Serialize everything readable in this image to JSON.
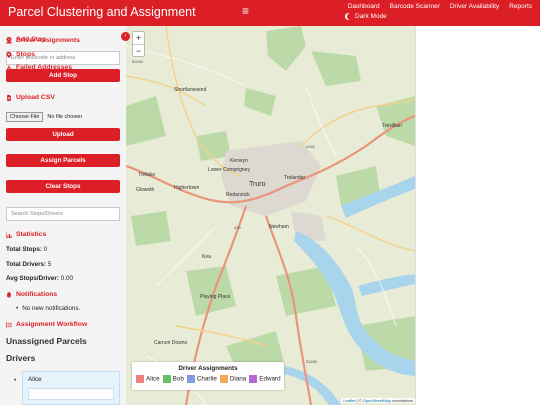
{
  "navbar": {
    "brand": "Parcel Clustering and Assignment",
    "hamburger": "≡",
    "links": [
      "Dashboard",
      "Barcode Scanner",
      "Driver Availability",
      "Reports"
    ],
    "dark_mode": "Dark Mode"
  },
  "sidebar": {
    "collapse": "‹",
    "add_stop": {
      "heading": "Add Stop",
      "placeholder": "Enter postcode or address",
      "button": "Add Stop"
    },
    "upload": {
      "heading": "Upload CSV",
      "file_button": "Choose File",
      "file_status": "No file chosen",
      "button": "Upload"
    },
    "assign_button": "Assign Parcels",
    "clear_button": "Clear Stops",
    "search_placeholder": "Search Stops/Drivers",
    "statistics": {
      "heading": "Statistics",
      "total_stops_label": "Total Stops:",
      "total_stops": "0",
      "total_drivers_label": "Total Drivers:",
      "total_drivers": "5",
      "avg_label": "Avg Stops/Driver:",
      "avg": "0.00"
    },
    "notifications": {
      "heading": "Notifications",
      "items": [
        "No new notifications."
      ]
    },
    "workflow_heading": "Assignment Workflow",
    "unassigned_heading": "Unassigned Parcels",
    "drivers_heading": "Drivers",
    "drivers": [
      {
        "name": "Alice"
      }
    ]
  },
  "map": {
    "zoom_in": "+",
    "zoom_out": "−",
    "place_labels": [
      "Shortlanesend",
      "Kenwyn",
      "Lower Comprigney",
      "Truro",
      "Trelander",
      "Gloweth",
      "Highertown",
      "Redannick",
      "Newham",
      "Treliske",
      "Kea",
      "Playing Place",
      "Carnon Downs",
      "Tresillian"
    ],
    "road_labels": [
      "B3284",
      "A390",
      "A39",
      "B3289"
    ],
    "legend": {
      "title": "Driver Assignments",
      "items": [
        {
          "name": "Alice",
          "color": "#f08080"
        },
        {
          "name": "Bob",
          "color": "#66c266"
        },
        {
          "name": "Charlie",
          "color": "#7f9fe0"
        },
        {
          "name": "Diana",
          "color": "#f0a860"
        },
        {
          "name": "Edward",
          "color": "#b06ad0"
        }
      ]
    },
    "attribution": {
      "leaflet": "Leaflet",
      "separator": " | © ",
      "osm": "OpenStreetMap",
      "contributors": " contributors"
    }
  },
  "right_panel": {
    "items": [
      "Driver Assignments",
      "Stops",
      "Failed Addresses"
    ]
  },
  "colors": {
    "accent": "#dc1f26"
  }
}
